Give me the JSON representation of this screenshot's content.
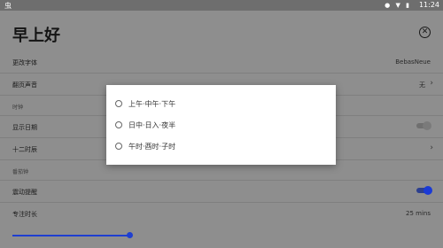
{
  "statusbar": {
    "app_icon": "虫",
    "icons": [
      "location-icon",
      "wifi-icon",
      "battery-icon"
    ],
    "time": "11:24"
  },
  "header": {
    "title": "早上好",
    "close_icon": "close-circle-icon"
  },
  "settings": {
    "font_row": {
      "label": "更改字体",
      "value": "BebasNeue"
    },
    "sound_row": {
      "label": "翻页声音",
      "value": "无"
    },
    "clock_section": "时钟",
    "show_date_row": {
      "label": "显示日期",
      "toggle": "off"
    },
    "twelve_hour_row": {
      "label": "十二时辰",
      "chevron": "›"
    },
    "focus_section": "番茄钟",
    "vibrate_row": {
      "label": "震动提醒",
      "toggle": "on"
    },
    "duration_row": {
      "label": "专注时长",
      "value": "25 mins"
    },
    "duration_slider_fraction": 0.28
  },
  "dialog": {
    "options": [
      "上午·中午·下午",
      "日中·日入·夜半",
      "午时·酉时·子时"
    ]
  },
  "colors": {
    "accent": "#1f3fd0",
    "dim_overlay_background": "#8e8e8e",
    "dialog_background": "#ffffff"
  }
}
